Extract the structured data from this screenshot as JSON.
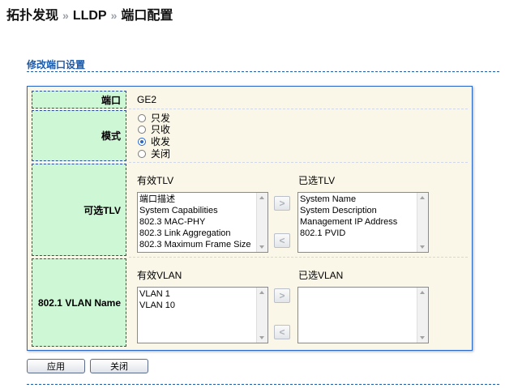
{
  "breadcrumb": {
    "items": [
      "拓扑发现",
      "LLDP",
      "端口配置"
    ],
    "separator": "»"
  },
  "section_title": "修改端口设置",
  "form": {
    "port": {
      "label": "端口",
      "value": "GE2"
    },
    "mode": {
      "label": "模式",
      "options": [
        "只发",
        "只收",
        "收发",
        "关闭"
      ],
      "selected": "收发"
    },
    "tlv": {
      "label": "可选TLV",
      "available_caption": "有效TLV",
      "selected_caption": "已选TLV",
      "available": [
        "端口描述",
        "System Capabilities",
        "802.3 MAC-PHY",
        "802.3 Link Aggregation",
        "802.3 Maximum Frame Size"
      ],
      "selected": [
        "System Name",
        "System Description",
        "Management IP Address",
        "802.1 PVID"
      ]
    },
    "vlan_name": {
      "label": "802.1 VLAN Name",
      "available_caption": "有效VLAN",
      "selected_caption": "已选VLAN",
      "available": [
        "VLAN 1",
        "VLAN 10"
      ],
      "selected": []
    },
    "move_right_icon": "chevron-right-icon",
    "move_left_icon": "chevron-left-icon"
  },
  "buttons": {
    "apply": "应用",
    "close": "关闭"
  },
  "colors": {
    "accent": "#1d5aa8",
    "label_bg": "#cef7d6",
    "panel_bg": "#faf7e8"
  }
}
